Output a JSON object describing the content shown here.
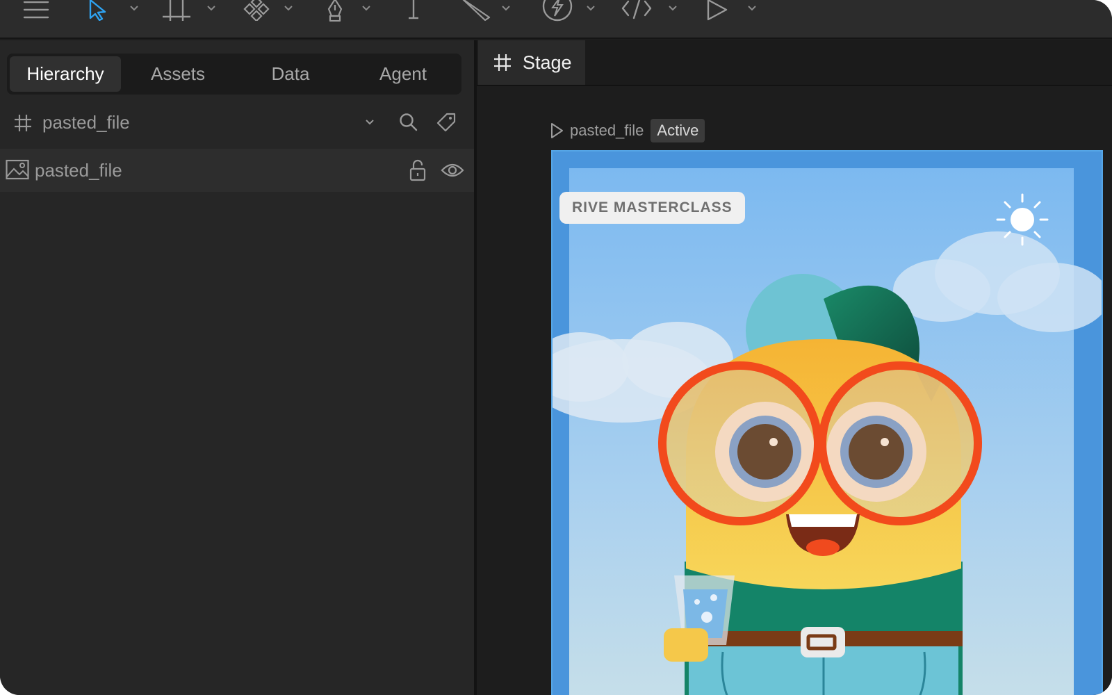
{
  "toolbar": {
    "tools": [
      {
        "name": "menu-icon"
      },
      {
        "name": "select-arrow-icon",
        "active": true
      },
      {
        "name": "frame-tool-icon"
      },
      {
        "name": "components-icon"
      },
      {
        "name": "pen-tool-icon"
      },
      {
        "name": "text-cursor-icon"
      },
      {
        "name": "knife-tool-icon"
      },
      {
        "name": "lightning-icon"
      },
      {
        "name": "code-icon"
      },
      {
        "name": "play-icon"
      }
    ],
    "accent_color": "#2ea3f2"
  },
  "left_panel": {
    "tabs": [
      {
        "label": "Hierarchy",
        "active": true
      },
      {
        "label": "Assets"
      },
      {
        "label": "Data"
      },
      {
        "label": "Agent"
      }
    ],
    "artboard_row": {
      "label": "pasted_file"
    },
    "layers": [
      {
        "label": "pasted_file",
        "type": "image",
        "locked": false,
        "visible": true
      }
    ]
  },
  "stage": {
    "tab_label": "Stage",
    "artboard_label": "pasted_file",
    "state_badge": "Active",
    "artwork": {
      "tag_text": "RIVE MASTERCLASS",
      "selection_color": "#56a6e6"
    }
  }
}
